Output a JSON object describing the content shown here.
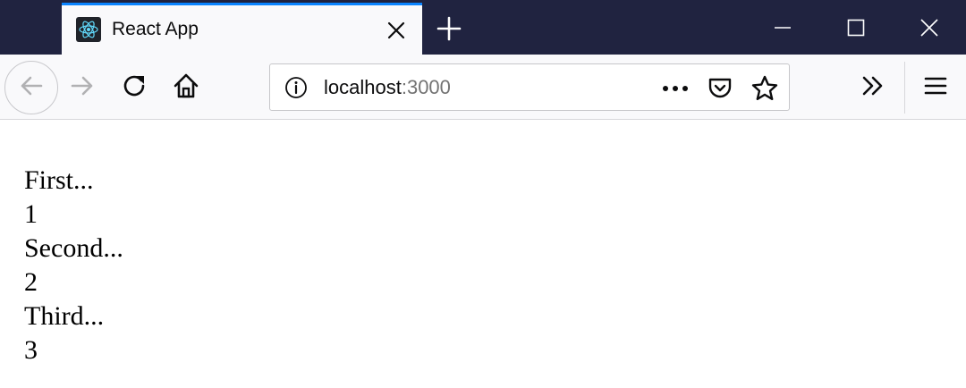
{
  "browser": {
    "tab": {
      "title": "React App",
      "favicon": "react-logo-icon"
    },
    "url": {
      "host": "localhost",
      "port": ":3000"
    },
    "icons": {
      "close_tab": "close-icon",
      "new_tab": "plus-icon",
      "back": "arrow-left-icon",
      "forward": "arrow-right-icon",
      "reload": "reload-icon",
      "home": "home-icon",
      "info": "info-icon",
      "more": "more-icon",
      "pocket": "pocket-icon",
      "bookmark": "star-icon",
      "overflow": "double-chevron-icon",
      "menu": "hamburger-icon"
    },
    "colors": {
      "titlebar": "#202340",
      "tab_accent": "#0a84ff",
      "toolbar": "#f9f9fb",
      "react_blue": "#61dafb"
    }
  },
  "page": {
    "lines": [
      "First...",
      "1",
      "Second...",
      "2",
      "Third...",
      "3"
    ]
  }
}
